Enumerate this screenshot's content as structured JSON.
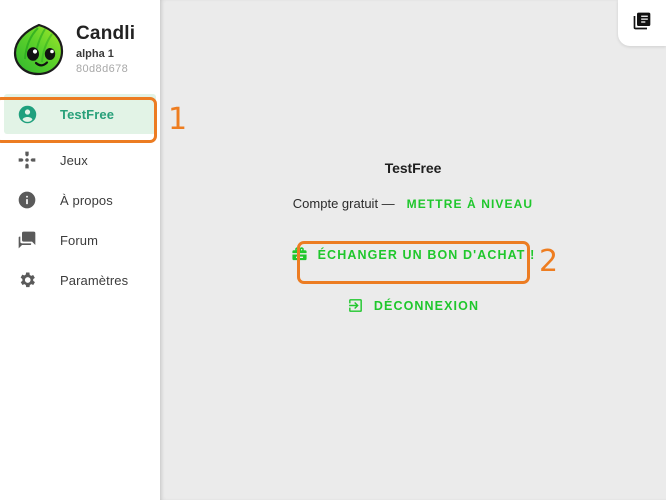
{
  "app": {
    "brand_name": "Candli",
    "version_label": "alpha 1",
    "build_id": "80d8d678",
    "logo_icon": "candli-leaf-mascot-logo"
  },
  "topbar": {
    "library_icon": "library-books-icon"
  },
  "sidebar": {
    "items": [
      {
        "id": "account",
        "label": "TestFree",
        "icon": "account-circle-icon",
        "active": true
      },
      {
        "id": "games",
        "label": "Jeux",
        "icon": "gamepad-dpad-icon",
        "active": false
      },
      {
        "id": "about",
        "label": "À propos",
        "icon": "info-circle-icon",
        "active": false
      },
      {
        "id": "forum",
        "label": "Forum",
        "icon": "forum-bubbles-icon",
        "active": false
      },
      {
        "id": "settings",
        "label": "Paramètres",
        "icon": "gear-icon",
        "active": false
      }
    ]
  },
  "main": {
    "account_name": "TestFree",
    "plan_label": "Compte gratuit —",
    "upgrade_link": "METTRE À NIVEAU",
    "redeem_button": "ÉCHANGER UN BON D'ACHAT !",
    "redeem_icon": "redeem-gift-card-icon",
    "logout_button": "DÉCONNEXION",
    "logout_icon": "exit-to-app-icon"
  },
  "annotations": [
    {
      "id": "1",
      "number": "1",
      "target": "sidebar-item-account"
    },
    {
      "id": "2",
      "number": "2",
      "target": "redeem-voucher-button"
    }
  ],
  "colors": {
    "accent_orange": "#ec7c22",
    "green_link": "#1fc72c",
    "active_teal": "#28a07a",
    "active_bg": "#e2f3e6",
    "main_bg": "#ebebeb",
    "sidebar_bg": "#ffffff"
  }
}
